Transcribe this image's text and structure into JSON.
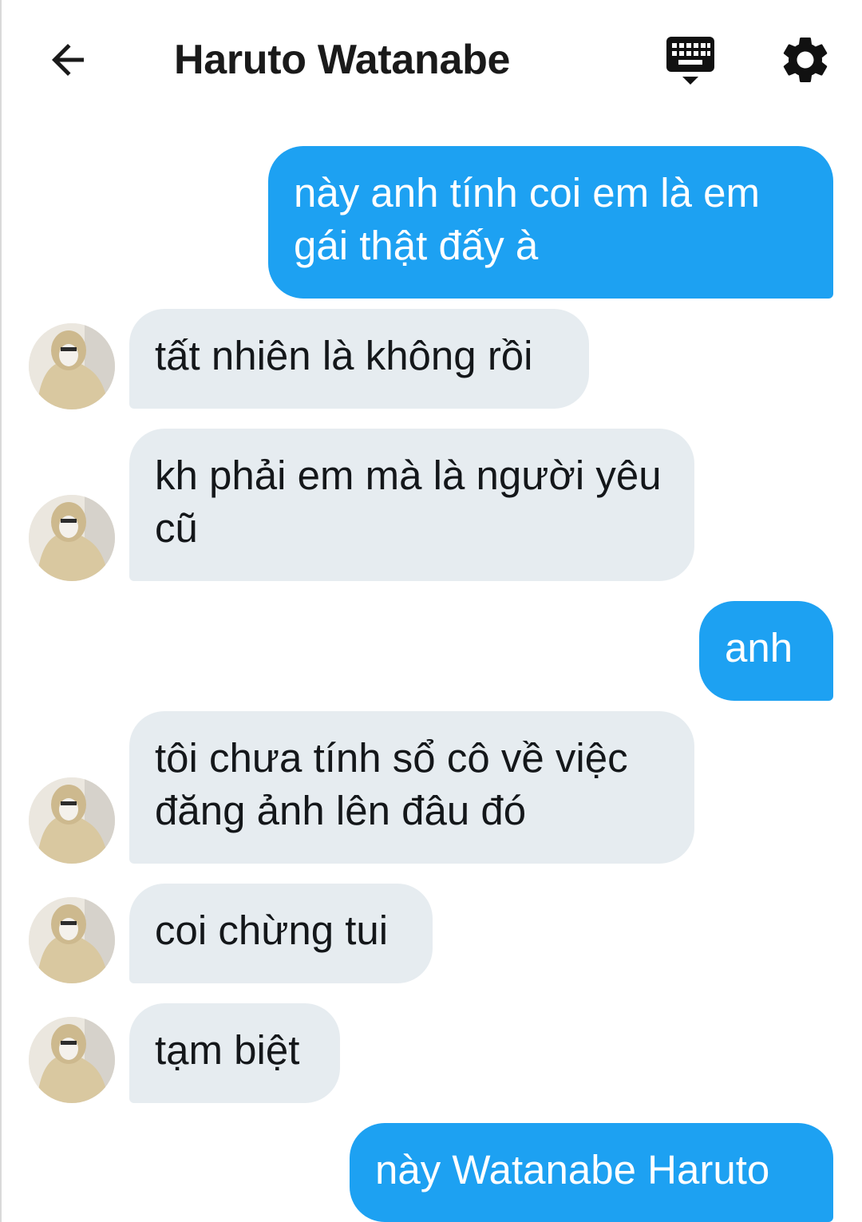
{
  "header": {
    "title": "Haruto Watanabe",
    "back_icon": "arrow-left-icon",
    "keyboard_icon": "keyboard-icon",
    "settings_icon": "gear-icon"
  },
  "messages": [
    {
      "side": "out",
      "text": "này anh tính coi em là em gái thật đấy à"
    },
    {
      "side": "in",
      "text": "tất nhiên là không rồi"
    },
    {
      "side": "in",
      "text": "kh phải em mà là người yêu cũ"
    },
    {
      "side": "out",
      "text": "anh"
    },
    {
      "side": "in",
      "text": "tôi chưa tính sổ cô về việc đăng ảnh lên đâu đó"
    },
    {
      "side": "in",
      "text": "coi chừng tui"
    },
    {
      "side": "in",
      "text": "tạm biệt"
    },
    {
      "side": "out",
      "text": "này Watanabe Haruto"
    }
  ],
  "colors": {
    "outgoing_bubble": "#1da1f2",
    "incoming_bubble": "#e6ecf0",
    "text_dark": "#14171a"
  }
}
